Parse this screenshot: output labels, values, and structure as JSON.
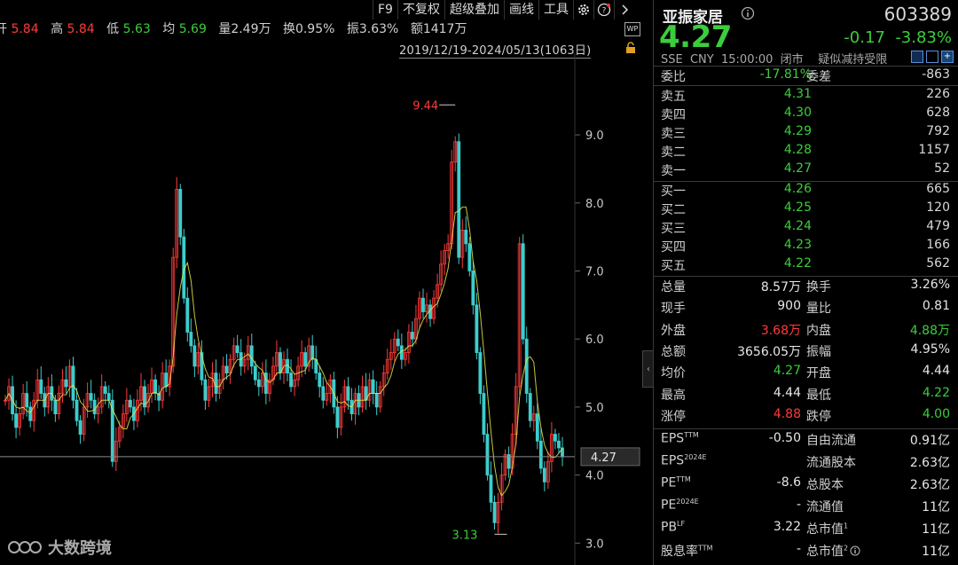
{
  "toolbar": {
    "items": [
      "F9",
      "不复权",
      "超级叠加",
      "画线",
      "工具"
    ]
  },
  "quote_bar": {
    "open_label": "开",
    "open": "5.84",
    "high_label": "高",
    "high": "5.84",
    "low_label": "低",
    "low": "5.63",
    "avg_label": "均",
    "avg": "5.69",
    "vol_label": "量",
    "vol": "2.49万",
    "turn_label": "换",
    "turn": "0.95%",
    "amp_label": "振",
    "amp": "3.63%",
    "amt_label": "额",
    "amt": "1417万"
  },
  "date_range": "2019/12/19-2024/05/13(1063日)",
  "wp_badge": "WP",
  "watermark": "大数跨境",
  "stock": {
    "name": "亚振家居",
    "code": "603389",
    "price": "4.27",
    "change": "-0.17",
    "change_pct": "-3.83%",
    "exchange": "SSE",
    "currency": "CNY",
    "time": "15:00:00",
    "status": "闭市",
    "note": "疑似减持受限"
  },
  "ratio": {
    "wb_label": "委比",
    "wb": "-17.81%",
    "wc_label": "委差",
    "wc": "-863"
  },
  "asks": [
    {
      "label": "卖五",
      "price": "4.31",
      "vol": "226"
    },
    {
      "label": "卖四",
      "price": "4.30",
      "vol": "628"
    },
    {
      "label": "卖三",
      "price": "4.29",
      "vol": "792"
    },
    {
      "label": "卖二",
      "price": "4.28",
      "vol": "1157"
    },
    {
      "label": "卖一",
      "price": "4.27",
      "vol": "52"
    }
  ],
  "bids": [
    {
      "label": "买一",
      "price": "4.26",
      "vol": "665"
    },
    {
      "label": "买二",
      "price": "4.25",
      "vol": "120"
    },
    {
      "label": "买三",
      "price": "4.24",
      "vol": "479"
    },
    {
      "label": "买四",
      "price": "4.23",
      "vol": "166"
    },
    {
      "label": "买五",
      "price": "4.22",
      "vol": "562"
    }
  ],
  "stats": [
    {
      "l1": "总量",
      "v1": "8.57万",
      "c1": "white",
      "l2": "换手",
      "v2": "3.26%",
      "c2": "white"
    },
    {
      "l1": "现手",
      "v1": "900",
      "c1": "white",
      "l2": "量比",
      "v2": "0.81",
      "c2": "white"
    },
    {
      "l1": "外盘",
      "v1": "3.68万",
      "c1": "red",
      "l2": "内盘",
      "v2": "4.88万",
      "c2": "green"
    },
    {
      "l1": "总额",
      "v1": "3656.05万",
      "c1": "white",
      "l2": "振幅",
      "v2": "4.95%",
      "c2": "white"
    },
    {
      "l1": "均价",
      "v1": "4.27",
      "c1": "green",
      "l2": "开盘",
      "v2": "4.44",
      "c2": "white"
    },
    {
      "l1": "最高",
      "v1": "4.44",
      "c1": "white",
      "l2": "最低",
      "v2": "4.22",
      "c2": "green"
    },
    {
      "l1": "涨停",
      "v1": "4.88",
      "c1": "red",
      "l2": "跌停",
      "v2": "4.00",
      "c2": "green"
    }
  ],
  "fundamentals": [
    {
      "l1": "EPS",
      "s1": "TTM",
      "v1": "-0.50",
      "l2": "自由流通",
      "s2": "",
      "v2": "0.91亿"
    },
    {
      "l1": "EPS",
      "s1": "2024E",
      "v1": "",
      "l2": "流通股本",
      "s2": "",
      "v2": "2.63亿"
    },
    {
      "l1": "PE",
      "s1": "TTM",
      "v1": "-8.6",
      "l2": "总股本",
      "s2": "",
      "v2": "2.63亿"
    },
    {
      "l1": "PE",
      "s1": "2024E",
      "v1": "-",
      "l2": "流通值",
      "s2": "",
      "v2": "11亿"
    },
    {
      "l1": "PB",
      "s1": "LF",
      "v1": "3.22",
      "l2": "总市值",
      "s2": "1",
      "v2": "11亿"
    },
    {
      "l1": "股息率",
      "s1": "TTM",
      "v1": "-",
      "l2": "总市值",
      "s2": "2",
      "v2": "11亿"
    }
  ],
  "chart_data": {
    "type": "candlestick",
    "y_ticks": [
      "9.0",
      "8.0",
      "7.0",
      "6.0",
      "5.0",
      "4.0",
      "3.0"
    ],
    "ylim": [
      2.9,
      10.2
    ],
    "max_label": "9.44",
    "min_label": "3.13",
    "last_label": "4.27",
    "up_color": "#ff3b3b",
    "down_color": "#3ccdcd",
    "ma_color": "#e8e84a",
    "closes": [
      5.1,
      5.3,
      4.9,
      4.7,
      4.9,
      5.2,
      5.0,
      4.8,
      5.1,
      5.4,
      5.2,
      5.0,
      5.3,
      5.1,
      4.9,
      5.2,
      5.4,
      5.3,
      5.6,
      5.1,
      4.8,
      4.6,
      5.0,
      5.2,
      5.1,
      4.9,
      5.0,
      5.3,
      5.2,
      5.1,
      4.2,
      4.5,
      4.7,
      4.9,
      5.1,
      5.0,
      4.8,
      5.1,
      5.3,
      5.0,
      5.2,
      5.4,
      5.2,
      5.1,
      5.5,
      5.3,
      5.6,
      7.2,
      8.2,
      7.5,
      6.6,
      6.1,
      5.9,
      5.6,
      5.8,
      5.4,
      5.1,
      5.3,
      5.5,
      5.2,
      5.4,
      5.6,
      5.5,
      5.7,
      5.9,
      5.8,
      5.6,
      5.7,
      5.9,
      5.6,
      5.4,
      5.3,
      5.5,
      5.2,
      5.4,
      5.6,
      5.8,
      5.5,
      5.7,
      5.5,
      5.3,
      5.4,
      5.6,
      5.8,
      5.6,
      5.9,
      5.7,
      5.5,
      5.3,
      5.1,
      5.2,
      5.4,
      5.0,
      4.7,
      5.0,
      5.3,
      5.1,
      4.9,
      5.2,
      5.0,
      5.3,
      5.1,
      5.4,
      5.2,
      5.0,
      5.3,
      5.5,
      5.7,
      5.8,
      6.0,
      5.9,
      5.7,
      5.8,
      6.1,
      6.0,
      6.3,
      6.6,
      6.4,
      6.5,
      6.3,
      6.6,
      6.8,
      7.1,
      7.3,
      7.4,
      8.6,
      8.9,
      7.2,
      7.6,
      7.4,
      7.0,
      6.5,
      5.8,
      5.2,
      4.6,
      4.0,
      3.6,
      3.3,
      3.6,
      4.0,
      4.3,
      4.1,
      4.6,
      5.3,
      7.4,
      6.0,
      5.2,
      4.8,
      4.9,
      4.5,
      4.1,
      3.9,
      4.2,
      4.6,
      4.5,
      4.4,
      4.27
    ]
  }
}
